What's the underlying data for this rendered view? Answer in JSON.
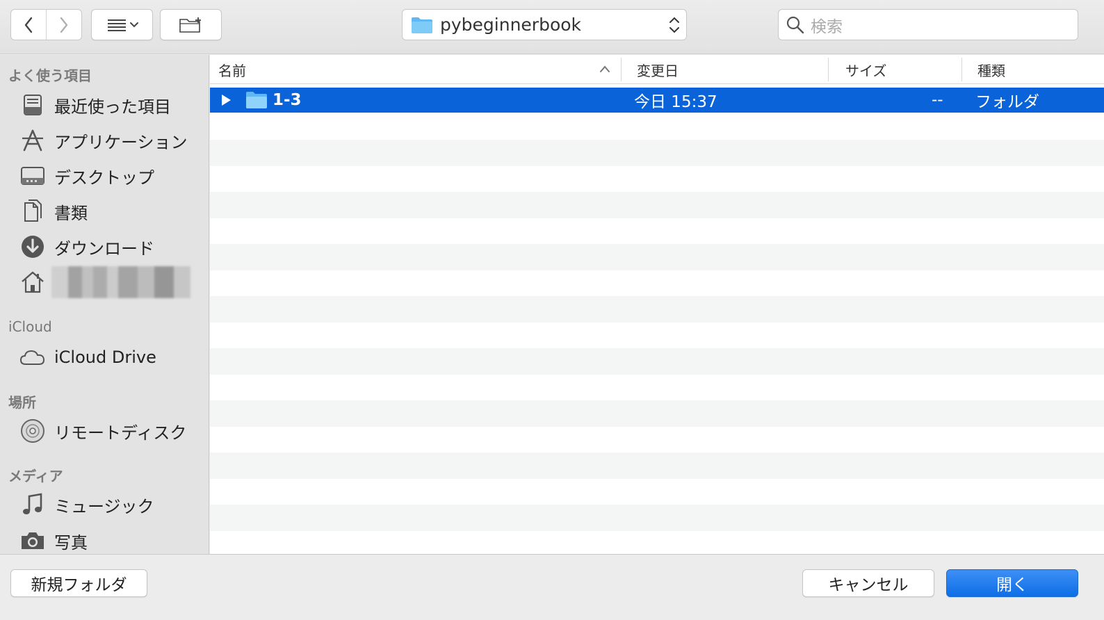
{
  "toolbar": {
    "path_folder_label": "pybeginnerbook",
    "search_placeholder": "検索"
  },
  "sidebar": {
    "sections": [
      {
        "title": "よく使う項目"
      },
      {
        "title": "iCloud"
      },
      {
        "title": "場所"
      },
      {
        "title": "メディア"
      }
    ],
    "favorites": [
      {
        "label": "最近使った項目",
        "icon": "recents-icon"
      },
      {
        "label": "アプリケーション",
        "icon": "applications-icon"
      },
      {
        "label": "デスクトップ",
        "icon": "desktop-icon"
      },
      {
        "label": "書類",
        "icon": "documents-icon"
      },
      {
        "label": "ダウンロード",
        "icon": "downloads-icon"
      },
      {
        "label": "",
        "icon": "home-icon"
      }
    ],
    "icloud": [
      {
        "label": "iCloud Drive",
        "icon": "cloud-icon"
      }
    ],
    "locations": [
      {
        "label": "リモートディスク",
        "icon": "disc-icon"
      }
    ],
    "media": [
      {
        "label": "ミュージック",
        "icon": "music-icon"
      },
      {
        "label": "写真",
        "icon": "camera-icon"
      }
    ]
  },
  "columns": {
    "name": "名前",
    "modified": "変更日",
    "size": "サイズ",
    "kind": "種類"
  },
  "files": [
    {
      "name": "1-3",
      "modified": "今日 15:37",
      "size": "--",
      "kind": "フォルダ",
      "selected": true
    }
  ],
  "buttons": {
    "new_folder": "新規フォルダ",
    "cancel": "キャンセル",
    "open": "開く"
  },
  "colors": {
    "selection": "#0a63d8",
    "folder": "#5fb8f4",
    "primary_button": "#0d6ee6"
  }
}
